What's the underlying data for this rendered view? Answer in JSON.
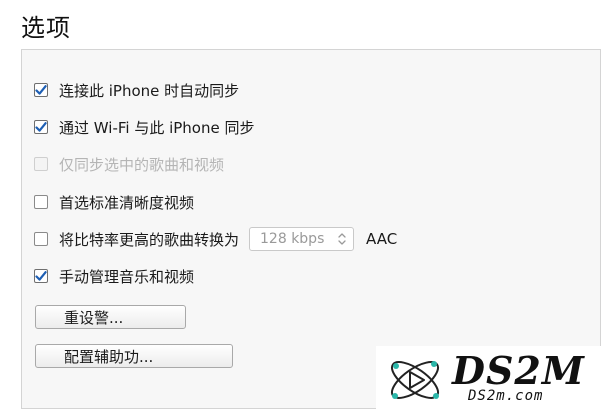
{
  "section": {
    "title": "选项"
  },
  "options": [
    {
      "label": "连接此 iPhone 时自动同步",
      "checked": true,
      "disabled": false
    },
    {
      "label": "通过 Wi-Fi 与此 iPhone 同步",
      "checked": true,
      "disabled": false
    },
    {
      "label": "仅同步选中的歌曲和视频",
      "checked": false,
      "disabled": true
    },
    {
      "label": "首选标准清晰度视频",
      "checked": false,
      "disabled": false
    },
    {
      "label": "将比特率更高的歌曲转换为",
      "checked": false,
      "disabled": false
    },
    {
      "label": "手动管理音乐和视频",
      "checked": true,
      "disabled": false
    }
  ],
  "bitrate": {
    "value": "128 kbps",
    "suffix": "AAC",
    "icon": "chevron-updown-icon"
  },
  "buttons": {
    "reset_warnings": "重设警...",
    "accessibility": "配置辅助功..."
  },
  "watermark": {
    "brand": "DS2M",
    "domain": "DS2m.com"
  },
  "colors": {
    "check_blue": "#1e5fb4",
    "disabled_text": "#b5b5b5",
    "panel_bg": "#f7f7f7"
  }
}
